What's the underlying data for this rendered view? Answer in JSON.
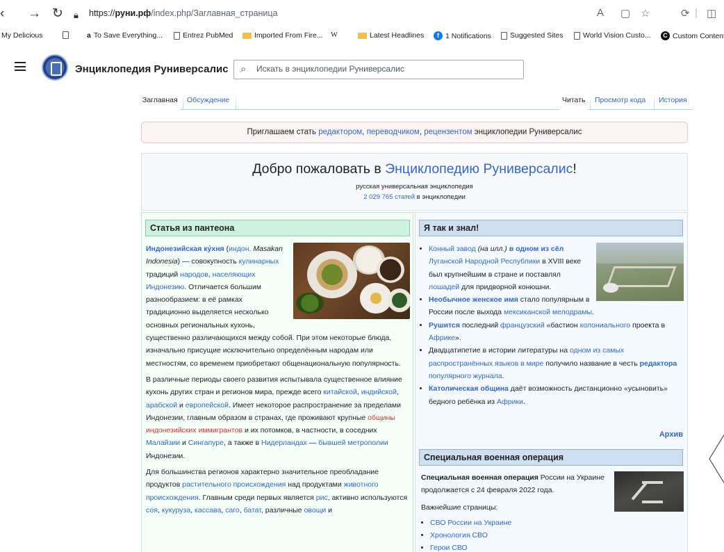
{
  "browser": {
    "url_scheme": "https://",
    "url_host": "руни.рф",
    "url_path": "/index.php/Заглавная_страница",
    "bookmarks": [
      {
        "label": "My Delicious",
        "icon": "none"
      },
      {
        "label": "",
        "icon": "page-icon"
      },
      {
        "label": "To Save Everything...",
        "icon": "amazon-icon"
      },
      {
        "label": "Entrez PubMed",
        "icon": "page-icon"
      },
      {
        "label": "Imported From Fire...",
        "icon": "folder-icon"
      },
      {
        "label": "W",
        "icon": "wikipedia-icon"
      },
      {
        "label": "Latest Headlines",
        "icon": "folder-icon"
      },
      {
        "label": "1 Notifications",
        "icon": "facebook-icon"
      },
      {
        "label": "Suggested Sites",
        "icon": "page-icon"
      },
      {
        "label": "World Vision Custo...",
        "icon": "page-icon"
      },
      {
        "label": "Custom Content",
        "icon": "custom-content-icon"
      }
    ]
  },
  "header": {
    "site_name": "Энциклопедия Руниверсалис",
    "search_placeholder": "Искать в энциклопедии Руниверсалис"
  },
  "tabs": {
    "main": "Заглавная",
    "talk": "Обсуждение",
    "read": "Читать",
    "view_source": "Просмотр кода",
    "history": "История"
  },
  "banner": {
    "prefix": "Приглашаем стать ",
    "link1": "редактором",
    "sep1": ", ",
    "link2": "переводчиком",
    "sep2": ", ",
    "link3": "рецензентом",
    "suffix": " энциклопедии Руниверсалис"
  },
  "welcome": {
    "heading_prefix": "Добро пожаловать в ",
    "heading_link": "Энциклопедию Руниверсалис",
    "heading_suffix": "!",
    "subtitle": "русская универсальная энциклопедия",
    "count_link": "2 029 765 статей",
    "count_suffix": " в энциклопедии"
  },
  "featured": {
    "title": "Статья из пантеона",
    "p1": {
      "t1": "Индонезийская ку́хня",
      "t2": " (",
      "t3": "индон.",
      "t4": " ",
      "t5": "Masakan Indonesia",
      "t6": ") — совокупность ",
      "t7": "кулинарных",
      "t8": " традиций ",
      "t9": "народов",
      "t10": ", ",
      "t11": "населяющих Индонезию",
      "t12": ". Отличается большим разнообразием: в её рамках традиционно выделяется несколько основных региональных кухонь, существенно различающихся между собой. При этом некоторые блюда, изначально присущие исключительно определённым народам или местностям, со временем приобретают общенациональную популярность."
    },
    "p2": {
      "t1": "В различные периоды своего развития испытывала существенное влияние кухонь других стран и регионов мира, прежде всего ",
      "t2": "китайской",
      "t3": ", ",
      "t4": "индийской",
      "t5": ", ",
      "t6": "арабской",
      "t7": " и ",
      "t8": "европейской",
      "t9": ". Имеет некоторое распространение за пределами Индонезии, главным образом в странах, где проживают крупные ",
      "t10": "общины индонезийских иммигрантов",
      "t11": " и их потомков, в частности, в соседних ",
      "t12": "Малайзии",
      "t13": " и ",
      "t14": "Сингапуре",
      "t15": ", а также в ",
      "t16": "Нидерландах",
      "t17": " — ",
      "t18": "бывшей метрополии",
      "t19": " Индонезии."
    },
    "p3": {
      "t1": "Для большинства регионов характерно значительное преобладание продуктов ",
      "t2": "растительного происхождения",
      "t3": " над продуктами ",
      "t4": "животного происхождения",
      "t5": ". Главным среди первых является ",
      "t6": "рис",
      "t7": ", активно используются ",
      "t8": "соя",
      "t9": ", ",
      "t10": "кукуруза",
      "t11": ", ",
      "t12": "кассава",
      "t13": ", ",
      "t14": "саго",
      "t15": ", ",
      "t16": "батат",
      "t17": ", различные ",
      "t18": "овощи",
      "t19": " и"
    }
  },
  "dyk": {
    "title": "Я так и знал!",
    "items": [
      {
        "a": "Конный завод",
        "b": " ",
        "c": "(на илл.)",
        "d": " ",
        "e": "в одном из сёл",
        "f": " ",
        "g": "Луганской Народной Республики",
        "h": " в XVIII веке был крупнейшим в стране и поставлял ",
        "i": "лошадей",
        "j": " для придворной конюшни."
      },
      {
        "a": "Необычное женское имя",
        "b": " стало популярным в России после выхода ",
        "c": "мексиканской мелодрамы",
        "d": "."
      },
      {
        "a": "Рушится",
        "b": " последний ",
        "c": "французский",
        "d": " «бастион ",
        "e": "колониального",
        "f": " проекта в ",
        "g": "Африке",
        "h": "»."
      },
      {
        "a": "Двадцатипетие в истории литературы на ",
        "b": "одном из самых распространённых языков в мире",
        "c": " получило название в честь ",
        "d": "редактора",
        "e": " ",
        "f": "популярного журнала",
        "g": "."
      },
      {
        "a": "Католическая община",
        "b": " даёт возможность дистанционно «усыновить» бедного ребёнка из ",
        "c": "Африки",
        "d": "."
      }
    ],
    "archive": "Архив"
  },
  "svo": {
    "title": "Специальная военная операция",
    "lead_bold": "Специальная военная операция",
    "lead_rest": " России на Украине продолжается с 24 февраля 2022 года.",
    "pages_label": "Важнейшие страницы:",
    "links": [
      "СВО России на Украине",
      "Хронология СВО",
      "Герои СВО"
    ]
  }
}
